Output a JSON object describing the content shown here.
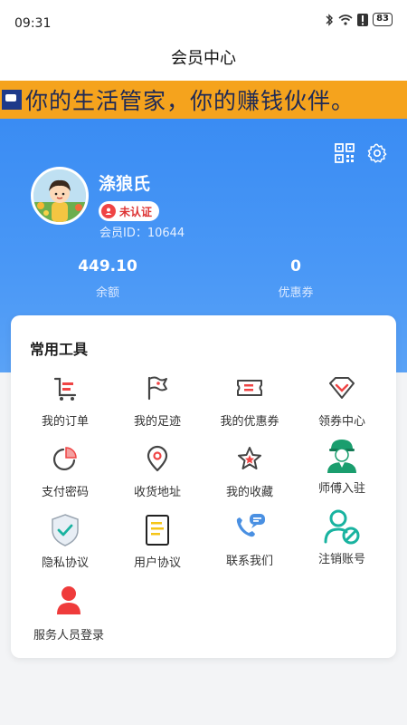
{
  "status": {
    "time": "09:31",
    "battery": "83"
  },
  "page_title": "会员中心",
  "banner": {
    "text": "你的生活管家，你的赚钱伙伴。"
  },
  "user": {
    "name": "涤狼氏",
    "cert_status": "未认证",
    "member_id": "会员ID：10644"
  },
  "stats": [
    {
      "value": "449.10",
      "label": "余额"
    },
    {
      "value": "0",
      "label": "优惠券"
    }
  ],
  "tools": {
    "title": "常用工具",
    "items": [
      {
        "label": "我的订单",
        "icon": "cart-icon"
      },
      {
        "label": "我的足迹",
        "icon": "flag-icon"
      },
      {
        "label": "我的优惠券",
        "icon": "ticket-icon"
      },
      {
        "label": "领券中心",
        "icon": "diamond-icon"
      },
      {
        "label": "支付密码",
        "icon": "pie-icon"
      },
      {
        "label": "收货地址",
        "icon": "location-icon"
      },
      {
        "label": "我的收藏",
        "icon": "star-icon"
      },
      {
        "label": "师傅入驻",
        "icon": "worker-icon"
      },
      {
        "label": "隐私协议",
        "icon": "shield-check-icon"
      },
      {
        "label": "用户协议",
        "icon": "document-icon"
      },
      {
        "label": "联系我们",
        "icon": "phone-chat-icon"
      },
      {
        "label": "注销账号",
        "icon": "user-cancel-icon"
      },
      {
        "label": "服务人员登录",
        "icon": "person-icon"
      }
    ]
  },
  "colors": {
    "primary_blue": "#3a8cf3",
    "banner_orange": "#f5a31d",
    "icon_red": "#ef4444",
    "icon_green": "#1a9e6e",
    "icon_teal": "#19b3a0"
  }
}
